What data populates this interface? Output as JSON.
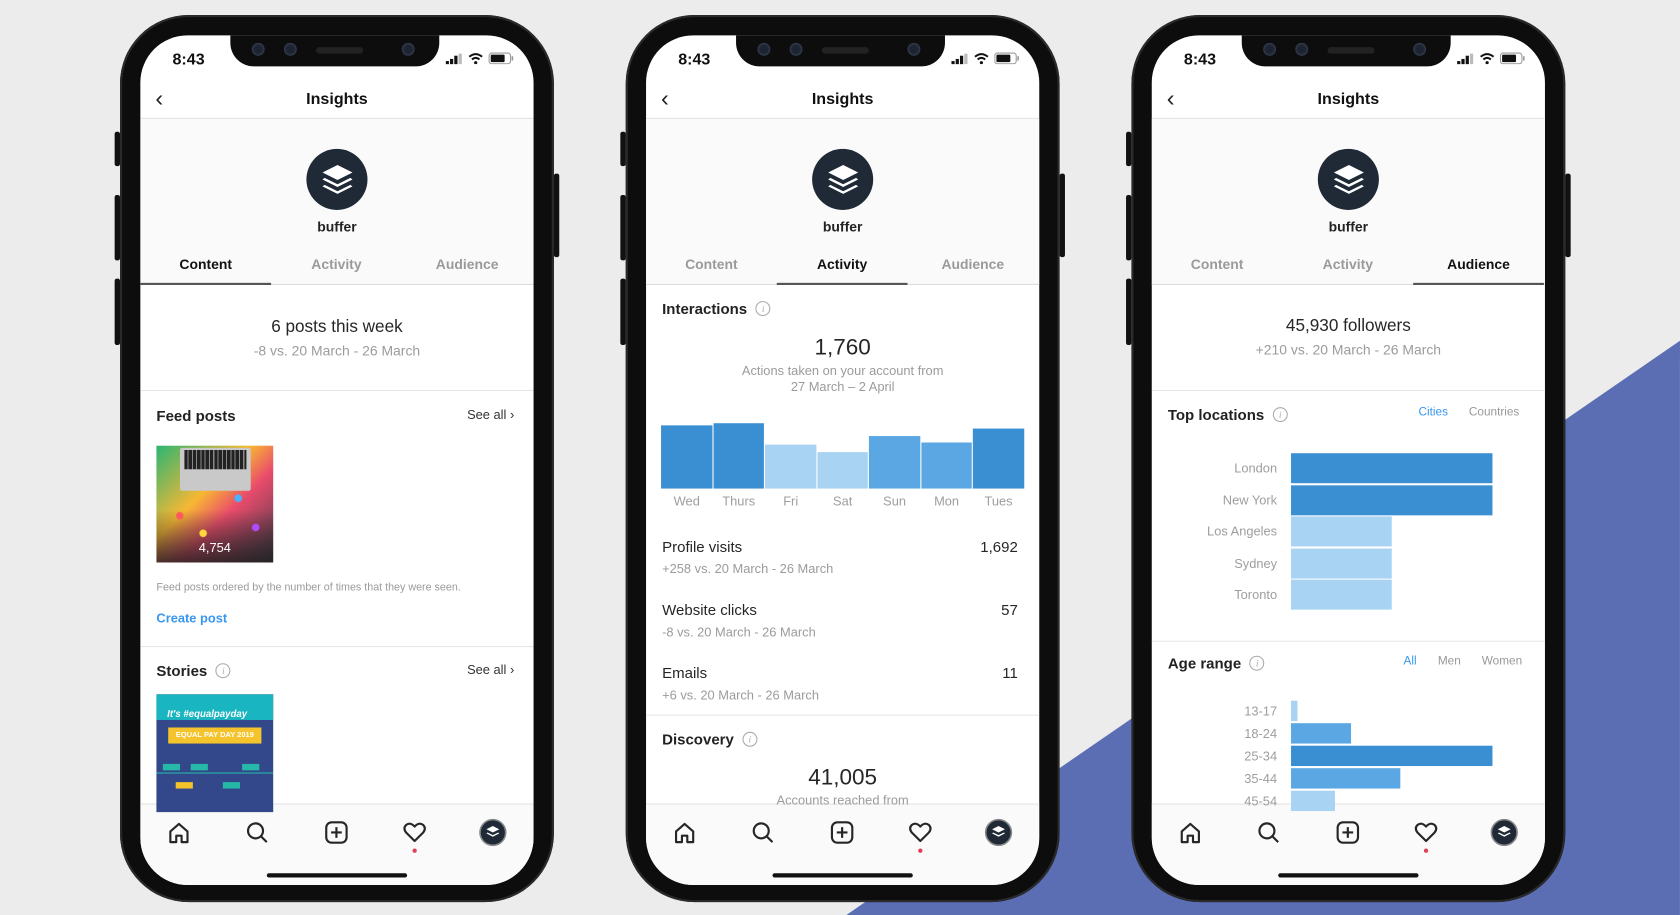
{
  "colors": {
    "accent": "#3897f0",
    "bar_dark": "#3a8fd3",
    "bar_mid": "#5aa7e3",
    "bar_light": "#a9d3f2",
    "background_shape": "#5b6db3"
  },
  "phones": [
    {
      "status_time": "8:43",
      "header_title": "Insights",
      "account_name": "buffer",
      "tabs": [
        "Content",
        "Activity",
        "Audience"
      ],
      "active_tab": 0
    },
    {
      "status_time": "8:43",
      "header_title": "Insights",
      "account_name": "buffer",
      "tabs": [
        "Content",
        "Activity",
        "Audience"
      ],
      "active_tab": 1
    },
    {
      "status_time": "8:43",
      "header_title": "Insights",
      "account_name": "buffer",
      "tabs": [
        "Content",
        "Activity",
        "Audience"
      ],
      "active_tab": 2
    }
  ],
  "content": {
    "summary": "6 posts this week",
    "summary_sub": "-8 vs. 20 March - 26 March",
    "feed_title": "Feed posts",
    "see_all": "See all",
    "post_count": "4,754",
    "feed_caption": "Feed posts ordered by the number of times that they were seen.",
    "create_post": "Create post",
    "stories_title": "Stories",
    "story_headline": "It's #equalpayday",
    "story_banner": "EQUAL PAY DAY 2019"
  },
  "activity": {
    "interactions_title": "Interactions",
    "total": "1,760",
    "total_sub_1": "Actions taken on your account from",
    "total_sub_2": "27 March – 2 April",
    "metrics": [
      {
        "label": "Profile visits",
        "value": "1,692",
        "sub": "+258 vs. 20 March - 26 March"
      },
      {
        "label": "Website clicks",
        "value": "57",
        "sub": "-8 vs. 20 March - 26 March"
      },
      {
        "label": "Emails",
        "value": "11",
        "sub": "+6 vs. 20 March - 26 March"
      }
    ],
    "discovery_title": "Discovery",
    "discovery_total": "41,005",
    "discovery_sub": "Accounts reached from"
  },
  "audience": {
    "followers": "45,930 followers",
    "followers_sub": "+210 vs. 20 March - 26 March",
    "locations_title": "Top locations",
    "location_filters": [
      "Cities",
      "Countries"
    ],
    "age_title": "Age range",
    "age_filters": [
      "All",
      "Men",
      "Women"
    ]
  },
  "chart_data": [
    {
      "type": "bar",
      "title": "",
      "categories": [
        "Wed",
        "Thurs",
        "Fri",
        "Sat",
        "Sun",
        "Mon",
        "Tues"
      ],
      "values": [
        97,
        100,
        67,
        56,
        80,
        70,
        92
      ],
      "shades": [
        "dark",
        "dark",
        "light",
        "light",
        "mid",
        "mid",
        "dark"
      ]
    },
    {
      "type": "bar",
      "orientation": "horizontal",
      "categories": [
        "London",
        "New York",
        "Los Angeles",
        "Sydney",
        "Toronto"
      ],
      "values": [
        100,
        100,
        50,
        50,
        50
      ],
      "shades": [
        "dark",
        "dark",
        "light",
        "light",
        "light"
      ]
    },
    {
      "type": "bar",
      "orientation": "horizontal",
      "categories": [
        "13-17",
        "18-24",
        "25-34",
        "35-44",
        "45-54"
      ],
      "values": [
        3,
        30,
        100,
        54,
        22
      ],
      "shades": [
        "light",
        "mid",
        "dark",
        "mid",
        "light"
      ]
    }
  ]
}
